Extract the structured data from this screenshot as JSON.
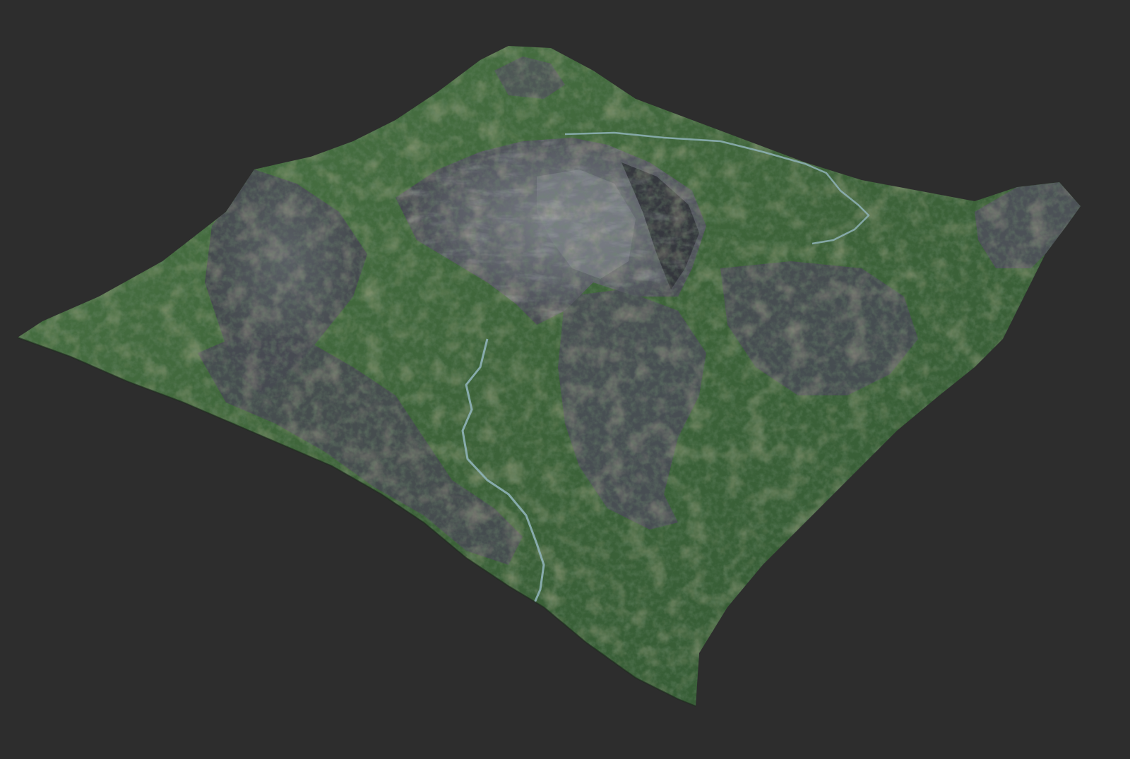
{
  "scene": {
    "background_color": "#2d2d2d",
    "subject": "terrain-heightmap-render",
    "colors": {
      "grass": "#3f6a3c",
      "grass_dark": "#2c4d2f",
      "grass_light": "#5e8450",
      "soil": "#9a8c66",
      "rock": "#5a5d66",
      "rock_dark": "#3a3c44",
      "rock_light": "#8a8d96",
      "river": "#8fb3b8"
    }
  }
}
